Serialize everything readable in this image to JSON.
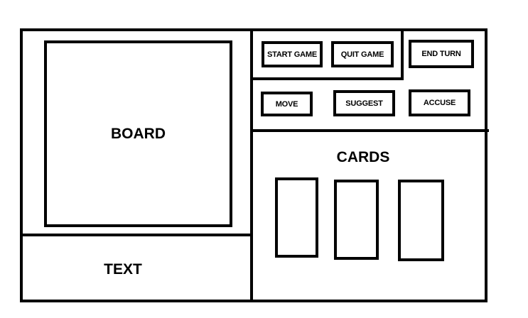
{
  "colors": {
    "stroke": "#000000",
    "background": "#ffffff"
  },
  "board": {
    "label": "BOARD"
  },
  "text_panel": {
    "label": "TEXT"
  },
  "controls": {
    "start_game": "START GAME",
    "quit_game": "QUIT GAME",
    "end_turn": "END TURN",
    "move": "MOVE",
    "suggest": "SUGGEST",
    "accuse": "ACCUSE"
  },
  "cards": {
    "label": "CARDS",
    "slots": [
      {
        "id": "card-1"
      },
      {
        "id": "card-2"
      },
      {
        "id": "card-3"
      }
    ]
  }
}
